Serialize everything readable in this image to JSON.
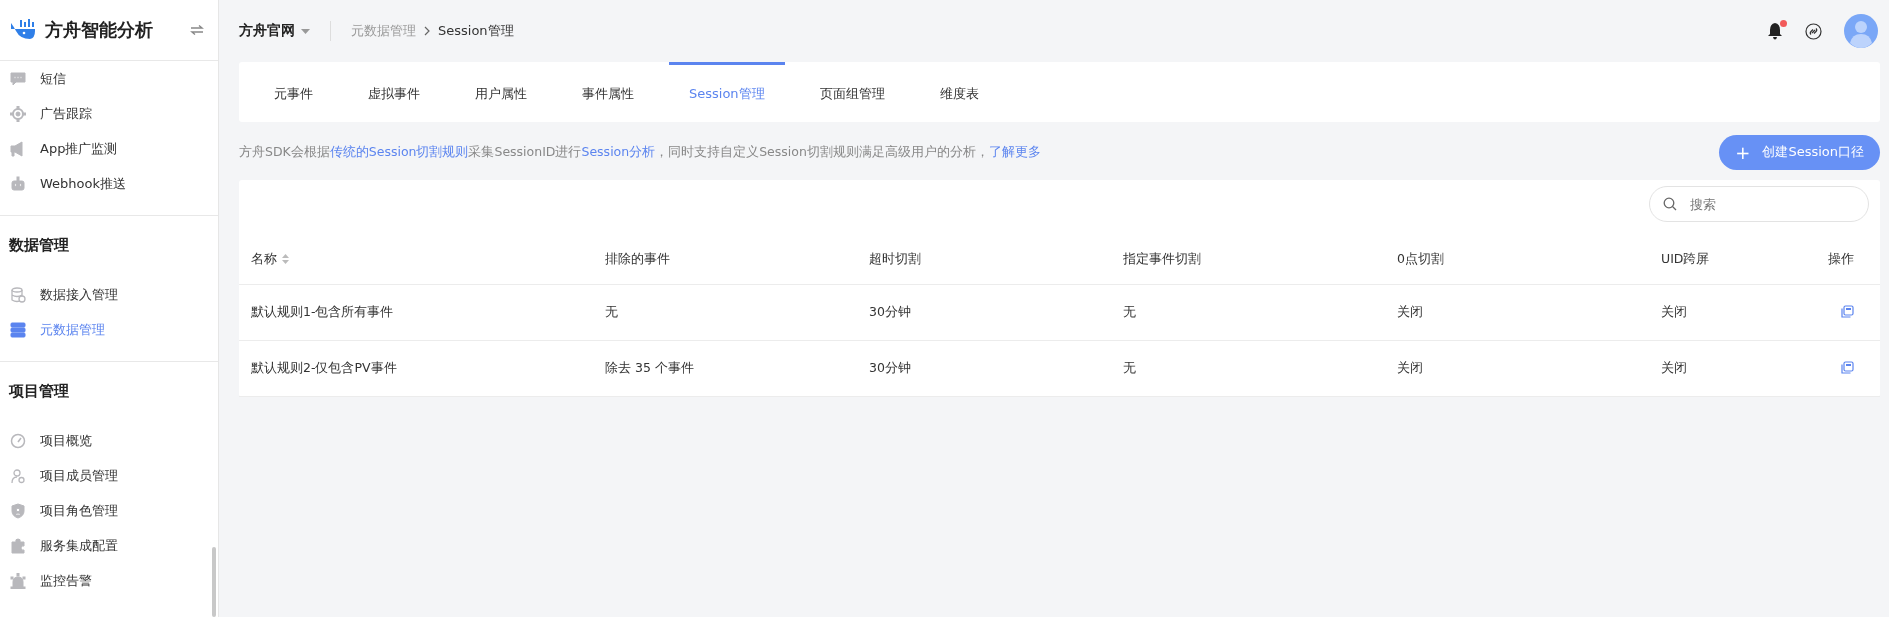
{
  "sidebar": {
    "brand": "方舟智能分析",
    "sections": [
      {
        "items": [
          {
            "label": "短信",
            "selected": false
          },
          {
            "label": "广告跟踪",
            "selected": false
          },
          {
            "label": "App推广监测",
            "selected": false
          },
          {
            "label": "Webhook推送",
            "selected": false
          }
        ]
      },
      {
        "title": "数据管理",
        "items": [
          {
            "label": "数据接入管理",
            "selected": false
          },
          {
            "label": "元数据管理",
            "selected": true
          }
        ]
      },
      {
        "title": "项目管理",
        "items": [
          {
            "label": "项目概览",
            "selected": false
          },
          {
            "label": "项目成员管理",
            "selected": false
          },
          {
            "label": "项目角色管理",
            "selected": false
          },
          {
            "label": "服务集成配置",
            "selected": false
          },
          {
            "label": "监控告警",
            "selected": false
          }
        ]
      }
    ]
  },
  "header": {
    "project": "方舟官网",
    "breadcrumb": [
      "元数据管理",
      "Session管理"
    ],
    "notification_dot": true
  },
  "tabs": [
    {
      "label": "元事件",
      "selected": false
    },
    {
      "label": "虚拟事件",
      "selected": false
    },
    {
      "label": "用户属性",
      "selected": false
    },
    {
      "label": "事件属性",
      "selected": false
    },
    {
      "label": "Session管理",
      "selected": true
    },
    {
      "label": "页面组管理",
      "selected": false
    },
    {
      "label": "维度表",
      "selected": false
    }
  ],
  "description": [
    {
      "kind": "text",
      "text": "方舟SDK会根据"
    },
    {
      "kind": "link",
      "text": "传统的Session切割规则"
    },
    {
      "kind": "text",
      "text": "采集SessionID进行"
    },
    {
      "kind": "link",
      "text": "Session分析"
    },
    {
      "kind": "text",
      "text": "，同时支持自定义Session切割规则满足高级用户的分析，"
    },
    {
      "kind": "link",
      "text": "了解更多"
    }
  ],
  "create_button": {
    "icon": "+",
    "label": "创建Session口径"
  },
  "search": {
    "placeholder": "搜索"
  },
  "table": {
    "columns": [
      {
        "label": "名称",
        "sortable": true
      },
      {
        "label": "排除的事件",
        "sortable": false
      },
      {
        "label": "超时切割",
        "sortable": false
      },
      {
        "label": "指定事件切割",
        "sortable": false
      },
      {
        "label": "0点切割",
        "sortable": false
      },
      {
        "label": "UID跨屏",
        "sortable": false
      },
      {
        "label": "操作",
        "sortable": false
      }
    ],
    "rows": [
      [
        "默认规则1-包含所有事件",
        "无",
        "30分钟",
        "无",
        "关闭",
        "关闭"
      ],
      [
        "默认规则2-仅包含PV事件",
        "除去 35 个事件",
        "30分钟",
        "无",
        "关闭",
        "关闭"
      ]
    ]
  }
}
